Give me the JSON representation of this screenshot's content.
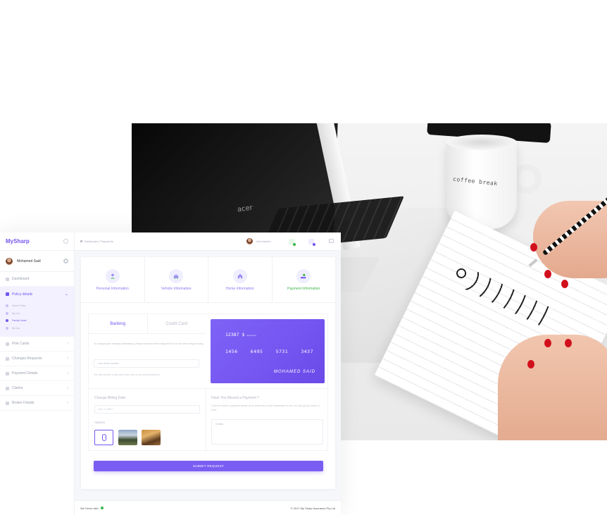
{
  "photo": {
    "laptop_brand": "acer",
    "mug_text": "coffee break"
  },
  "sidebar": {
    "logo": "MySharp",
    "user_name": "Mohamed Said",
    "items": [
      {
        "label": "Dashboard"
      },
      {
        "label": "Policy details"
      },
      {
        "label": "Pink Cards"
      },
      {
        "label": "Changes Requests"
      },
      {
        "label": "Payment Details"
      },
      {
        "label": "Claims"
      },
      {
        "label": "Broker Details"
      }
    ],
    "sub_items": [
      {
        "label": "Home Policy"
      },
      {
        "label": "My Car"
      },
      {
        "label": "Family Home"
      },
      {
        "label": "My Car"
      }
    ]
  },
  "topbar": {
    "breadcrumb": "Dashboard / Payments",
    "user_name": "John Harold ▾"
  },
  "colors": {
    "accent": "#7455f0",
    "success": "#3bb64b"
  },
  "steps": [
    {
      "label": "Personal Information",
      "icon": "person-icon"
    },
    {
      "label": "Vehicle Information",
      "icon": "car-icon"
    },
    {
      "label": "Home Information",
      "icon": "house-icon"
    },
    {
      "label": "Payment Information",
      "icon": "hand-coin-icon"
    }
  ],
  "tabs": {
    "banking": "Banking",
    "credit_card": "Credit Card"
  },
  "banking": {
    "copy": "To change your banking information, please have the direct deposit form to the next cheque ready.",
    "input_placeholder": "Your Bank number",
    "note": "You will receive a call back from one of our representatives."
  },
  "card": {
    "amount": "12387 $",
    "amount_suffix": "due amount",
    "number_groups": [
      "1456",
      "6495",
      "5731",
      "3437"
    ],
    "holder": "MOHAMED SAID"
  },
  "billing": {
    "label": "Change Billing Date",
    "value": "24 / 7 / 2017",
    "attach_label": "Attachs"
  },
  "missed": {
    "title": "Have You Missed a Payment ?",
    "copy": "If you've missed a payment please let us know with a brief explanation so we can help get you back on track.",
    "placeholder": "Details"
  },
  "submit_label": "SUBMIT REQUEST",
  "footer": {
    "left": "We Serve with",
    "right": "© 2017 My Sharp Insurance Pty Ltd"
  }
}
